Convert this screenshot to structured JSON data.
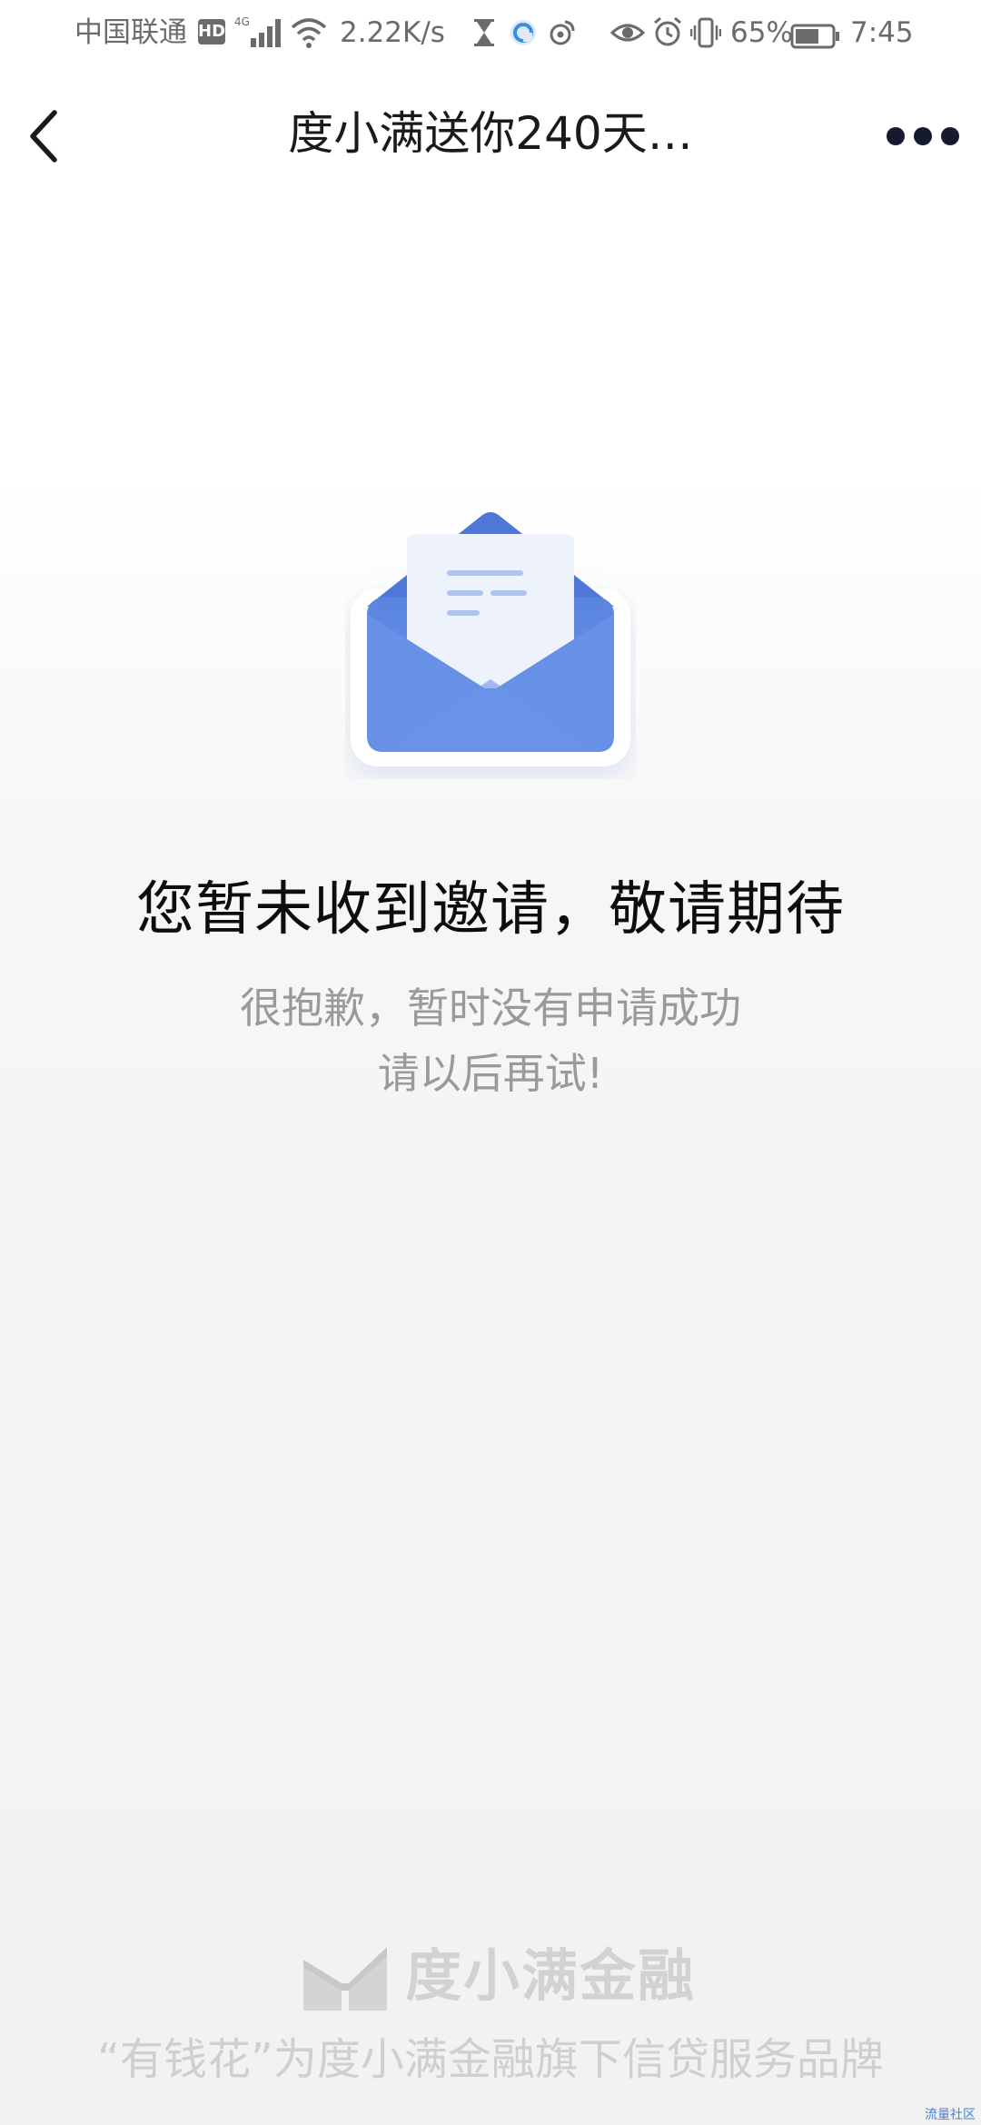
{
  "status_bar": {
    "carrier": "中国联通",
    "hd_badge": "HD",
    "network_type": "4G",
    "speed": "2.22K/s",
    "battery_percent": "65%",
    "time": "7:45",
    "icons": [
      "hd-icon",
      "signal-icon",
      "wifi-icon",
      "hourglass-icon",
      "app-notification-icon",
      "weibo-icon",
      "eye-icon",
      "alarm-icon",
      "vibrate-icon",
      "battery-icon"
    ]
  },
  "nav": {
    "title": "度小满送你240天…",
    "back_icon": "chevron-left-icon",
    "more_icon": "more-dots-icon"
  },
  "empty_state": {
    "illustration": "envelope-icon",
    "title": "您暂未收到邀请，敬请期待",
    "subtitle_line1": "很抱歉，暂时没有申请成功",
    "subtitle_line2": "请以后再试!"
  },
  "footer": {
    "brand_name": "度小满金融",
    "caption": "“有钱花”为度小满金融旗下信贷服务品牌",
    "watermark": "流量社区"
  },
  "colors": {
    "accent_blue": "#5b86e0",
    "title_text": "#0d0d0d",
    "subtitle_text": "#9a9a9a",
    "footer_text": "#cfcfcf"
  }
}
